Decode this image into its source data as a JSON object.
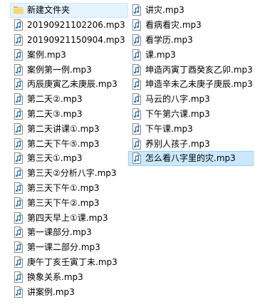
{
  "window": {
    "view": "file-list"
  },
  "columns": [
    {
      "items": [
        {
          "name": "新建文件夹",
          "type": "folder",
          "state": "selected"
        },
        {
          "name": "20190921102206.mp3",
          "type": "audio"
        },
        {
          "name": "20190921150904.mp3",
          "type": "audio"
        },
        {
          "name": "案例.mp3",
          "type": "audio"
        },
        {
          "name": "案例第一例.mp3",
          "type": "audio"
        },
        {
          "name": "丙辰庚寅乙未庚辰.mp3",
          "type": "audio"
        },
        {
          "name": "第二天②.mp3",
          "type": "audio"
        },
        {
          "name": "第二天③.mp3",
          "type": "audio"
        },
        {
          "name": "第二天讲课①.mp3",
          "type": "audio"
        },
        {
          "name": "第二天下午⑤.mp3",
          "type": "audio"
        },
        {
          "name": "第三天①.mp3",
          "type": "audio"
        },
        {
          "name": "第三天②分析八字.mp3",
          "type": "audio"
        },
        {
          "name": "第三天下午①.mp3",
          "type": "audio"
        },
        {
          "name": "第三天下午②.mp3",
          "type": "audio"
        },
        {
          "name": "第四天早上①课.mp3",
          "type": "audio"
        },
        {
          "name": "第一课部分.mp3",
          "type": "audio"
        },
        {
          "name": "第一课二部分.mp3",
          "type": "audio"
        },
        {
          "name": "庚午丁亥壬寅丁未.mp3",
          "type": "audio"
        },
        {
          "name": "换象关系.mp3",
          "type": "audio"
        },
        {
          "name": "讲案例.mp3",
          "type": "audio"
        }
      ]
    },
    {
      "items": [
        {
          "name": "讲灾.mp3",
          "type": "audio"
        },
        {
          "name": "看病看灾.mp3",
          "type": "audio"
        },
        {
          "name": "看学历.mp3",
          "type": "audio"
        },
        {
          "name": "课.mp3",
          "type": "audio"
        },
        {
          "name": "坤造丙寅丁酉癸亥乙卯.mp3",
          "type": "audio"
        },
        {
          "name": "坤造辛未乙未庚子庚辰.mp3",
          "type": "audio"
        },
        {
          "name": "马云的八字.mp3",
          "type": "audio"
        },
        {
          "name": "下午第六课.mp3",
          "type": "audio"
        },
        {
          "name": "下午课.mp3",
          "type": "audio"
        },
        {
          "name": "养别人孩子.mp3",
          "type": "audio"
        },
        {
          "name": "怎么看八字里的灾.mp3",
          "type": "audio",
          "state": "focused"
        }
      ]
    }
  ],
  "icons": {
    "audio": "audio-file-icon",
    "folder": "folder-icon"
  },
  "colors": {
    "selection_bg": "#e5f3ff",
    "selection_border": "#cce8ff",
    "focus_bg": "#cce8ff",
    "focus_border": "#99d1ff",
    "folder": "#f8d775",
    "audio_note": "#1c6fb8"
  }
}
